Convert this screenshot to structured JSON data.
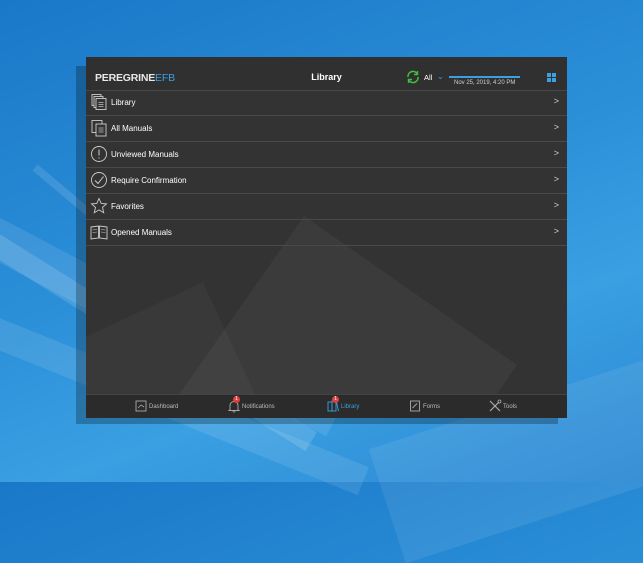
{
  "app": {
    "logo_main": "PEREGRINE",
    "logo_accent": "EFB",
    "title": "Library"
  },
  "header": {
    "filter_label": "All",
    "last_sync": "Nov 25, 2019, 4:20 PM"
  },
  "menu": {
    "items": [
      {
        "label": "Library",
        "icon": "library-icon"
      },
      {
        "label": "All Manuals",
        "icon": "manuals-icon"
      },
      {
        "label": "Unviewed Manuals",
        "icon": "exclamation-circle-icon"
      },
      {
        "label": "Require Confirmation",
        "icon": "checkmark-circle-icon"
      },
      {
        "label": "Favorites",
        "icon": "star-icon"
      },
      {
        "label": "Opened Manuals",
        "icon": "open-book-icon"
      }
    ]
  },
  "tabbar": {
    "tabs": [
      {
        "label": "Dashboard",
        "icon": "dashboard-icon"
      },
      {
        "label": "Notifications",
        "icon": "bell-icon",
        "badge": "1"
      },
      {
        "label": "Library",
        "icon": "library-tab-icon",
        "badge": "1",
        "active": true
      },
      {
        "label": "Forms",
        "icon": "forms-icon"
      },
      {
        "label": "Tools",
        "icon": "tools-icon"
      }
    ]
  },
  "colors": {
    "accent": "#3b9fe0",
    "sync": "#3fbf3f",
    "badge": "#e04040",
    "panel": "#333333"
  }
}
